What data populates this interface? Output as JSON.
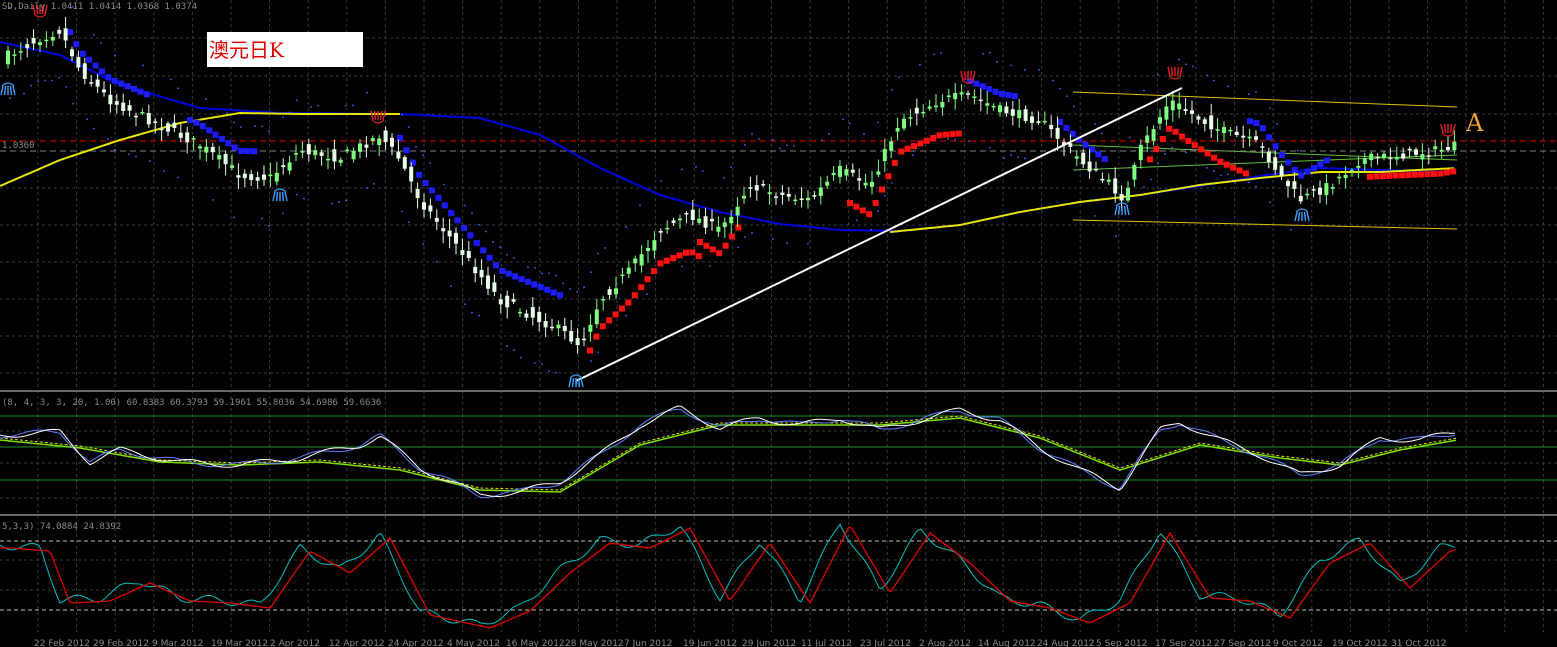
{
  "window": {
    "main_header": "SD,Daily 1.0411 1.0414 1.0368 1.0374",
    "price_marker": "1.0360",
    "macd_header": "(8, 4, 3, 3, 20, 1.00) 60.8383 60.3793 59.1961 55.8036 54.6986 59.6636",
    "stoch_header": "5,3,3) 74.0884 24.8392"
  },
  "title_label": "澳元日K",
  "annotation_a": "A",
  "colors": {
    "bull_candle": "#7fff7f",
    "bear_candle": "#e6ffe6",
    "ma_slow": "#0000e0",
    "ma_fast": "#e6e600",
    "sar_down": "#1c1cff",
    "sar_up": "#ff1010",
    "trendline": "#ffffff",
    "channel": "#e0c000",
    "red_level": "#e00000",
    "grid": "#3a3a3a",
    "stoch_k": "#00c0c0",
    "stoch_d": "#e00000"
  },
  "chart_data": [
    {
      "type": "candlestick",
      "title": "澳元日K",
      "symbol_header": "SD,Daily 1.0411 1.0414 1.0368 1.0374",
      "x_tick_labels": [
        "22 Feb 2012",
        "29 Feb 2012",
        "9 Mar 2012",
        "19 Mar 2012",
        "2 Apr 2012",
        "12 Apr 2012",
        "24 Apr 2012",
        "4 May 2012",
        "16 May 2012",
        "28 May 2012",
        "7 Jun 2012",
        "19 Jun 2012",
        "29 Jun 2012",
        "11 Jul 2012",
        "23 Jul 2012",
        "2 Aug 2012",
        "14 Aug 2012",
        "24 Aug 2012",
        "5 Sep 2012",
        "17 Sep 2012",
        "27 Sep 2012",
        "9 Oct 2012",
        "19 Oct 2012",
        "31 Oct 2012"
      ],
      "price_marker": "1.0360",
      "key_points": [
        {
          "x": "29 Feb 2012",
          "level": "high"
        },
        {
          "x": "28 May 2012",
          "level": "low"
        },
        {
          "x": "2 Aug 2012",
          "level": "high"
        },
        {
          "x": "17 Sep 2012",
          "level": "high"
        },
        {
          "x": "27 Sep 2012",
          "level": "low"
        },
        {
          "x": "31 Oct 2012",
          "level": "last"
        }
      ],
      "overlays": [
        "moving-average-slow",
        "moving-average-fast",
        "parabolic-sar",
        "trendline",
        "channel",
        "horizontal-level"
      ],
      "annotation": "A"
    },
    {
      "type": "line",
      "indicator_header": "(8, 4, 3, 3, 20, 1.00) 60.8383 60.3793 59.1961 55.8036 54.6986 59.6636",
      "series_count": 4,
      "levels": 3
    },
    {
      "type": "line",
      "indicator_header": "5,3,3) 74.0884 24.8392",
      "series_count": 2,
      "levels": 2
    }
  ]
}
